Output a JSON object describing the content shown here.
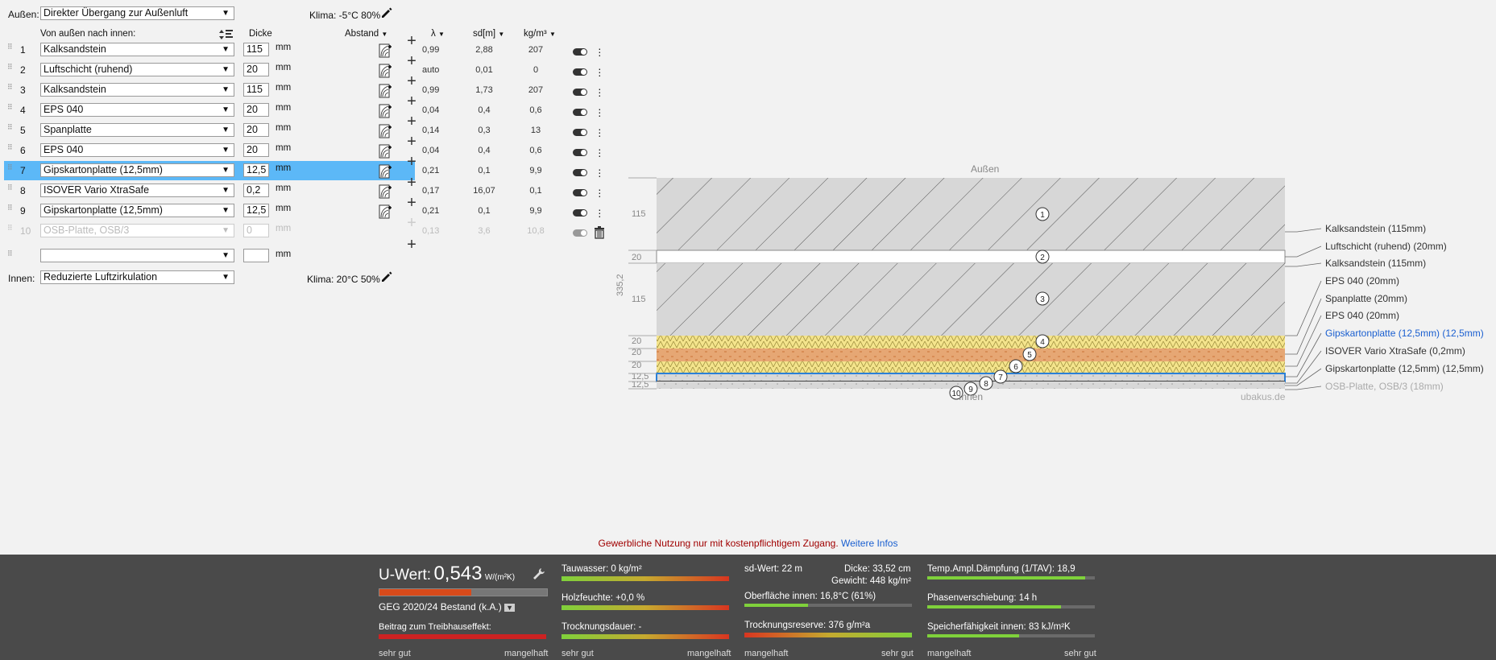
{
  "outside": {
    "label": "Außen:",
    "select": "Direkter Übergang zur Außenluft",
    "klima": "Klima: -5°C 80%"
  },
  "inside": {
    "label": "Innen:",
    "select": "Reduzierte Luftzirkulation",
    "klima": "Klima: 20°C 50%"
  },
  "headers": {
    "order": "Von außen nach innen:",
    "dicke": "Dicke",
    "abstand": "Abstand",
    "lambda": "λ",
    "sd": "sd[m]",
    "kg": "kg/m³",
    "mm": "mm"
  },
  "layers": [
    {
      "n": "1",
      "name": "Kalksandstein",
      "dicke": "115",
      "lambda": "0,99",
      "sd": "2,88",
      "kg": "207"
    },
    {
      "n": "2",
      "name": "Luftschicht (ruhend)",
      "dicke": "20",
      "lambda": "auto",
      "sd": "0,01",
      "kg": "0"
    },
    {
      "n": "3",
      "name": "Kalksandstein",
      "dicke": "115",
      "lambda": "0,99",
      "sd": "1,73",
      "kg": "207"
    },
    {
      "n": "4",
      "name": "EPS 040",
      "dicke": "20",
      "lambda": "0,04",
      "sd": "0,4",
      "kg": "0,6"
    },
    {
      "n": "5",
      "name": "Spanplatte",
      "dicke": "20",
      "lambda": "0,14",
      "sd": "0,3",
      "kg": "13"
    },
    {
      "n": "6",
      "name": "EPS 040",
      "dicke": "20",
      "lambda": "0,04",
      "sd": "0,4",
      "kg": "0,6"
    },
    {
      "n": "7",
      "name": "Gipskartonplatte (12,5mm)",
      "dicke": "12,5",
      "lambda": "0,21",
      "sd": "0,1",
      "kg": "9,9"
    },
    {
      "n": "8",
      "name": "ISOVER Vario XtraSafe",
      "dicke": "0,2",
      "lambda": "0,17",
      "sd": "16,07",
      "kg": "0,1"
    },
    {
      "n": "9",
      "name": "Gipskartonplatte (12,5mm)",
      "dicke": "12,5",
      "lambda": "0,21",
      "sd": "0,1",
      "kg": "9,9"
    },
    {
      "n": "10",
      "name": "OSB-Platte, OSB/3",
      "dicke": "0",
      "lambda": "0,13",
      "sd": "3,6",
      "kg": "10,8"
    }
  ],
  "diagram": {
    "top_label": "Außen",
    "bottom_label": "Innen",
    "total": "335,2",
    "watermark": "ubakus.de",
    "dims": [
      "115",
      "20",
      "115",
      "20",
      "20",
      "20",
      "12,5",
      "12,5"
    ],
    "circles": [
      "1",
      "2",
      "3",
      "4",
      "5",
      "6",
      "7",
      "8",
      "9",
      "10"
    ],
    "legend": [
      "Kalksandstein (115mm)",
      "Luftschicht (ruhend) (20mm)",
      "Kalksandstein (115mm)",
      "EPS 040 (20mm)",
      "Spanplatte (20mm)",
      "EPS 040 (20mm)",
      "Gipskartonplatte (12,5mm) (12,5mm)",
      "ISOVER Vario XtraSafe (0,2mm)",
      "Gipskartonplatte (12,5mm) (12,5mm)",
      "OSB-Platte, OSB/3 (18mm)"
    ]
  },
  "notice": {
    "text": "Gewerbliche Nutzung nur mit kostenpflichtigem Zugang.",
    "link": "Weitere Infos"
  },
  "footer": {
    "uwert_label": "U-Wert:",
    "uwert_value": "0,543",
    "uwert_unit": "W/(m²K)",
    "uwert_level": 0.55,
    "geg": "GEG 2020/24 Bestand (k.A.)",
    "treibhaus": "Beitrag zum Treibhauseffekt:",
    "tauwasser": "Tauwasser: 0 kg/m²",
    "holzfeuchte": "Holzfeuchte: +0,0 %",
    "trocknungsdauer": "Trocknungsdauer: -",
    "sdwert": "sd-Wert: 22 m",
    "dicke": "Dicke: 33,52 cm",
    "gewicht": "Gewicht: 448 kg/m²",
    "oberflaeche": "Oberfläche innen: 16,8°C (61%)",
    "oberflaeche_level": 0.38,
    "trocknungsreserve": "Trocknungsreserve: 376 g/m²a",
    "temp_ampl": "Temp.Ampl.Dämpfung (1/TAV): 18,9",
    "temp_ampl_level": 0.94,
    "phasen": "Phasenverschiebung: 14 h",
    "phasen_level": 0.8,
    "speicher": "Speicherfähigkeit innen: 83 kJ/m²K",
    "speicher_level": 0.55,
    "sehr_gut": "sehr gut",
    "mangelhaft": "mangelhaft"
  },
  "colors": {
    "selected_row": "#5cb8f7",
    "link": "#1a5fd0",
    "notice": "#a00000"
  }
}
